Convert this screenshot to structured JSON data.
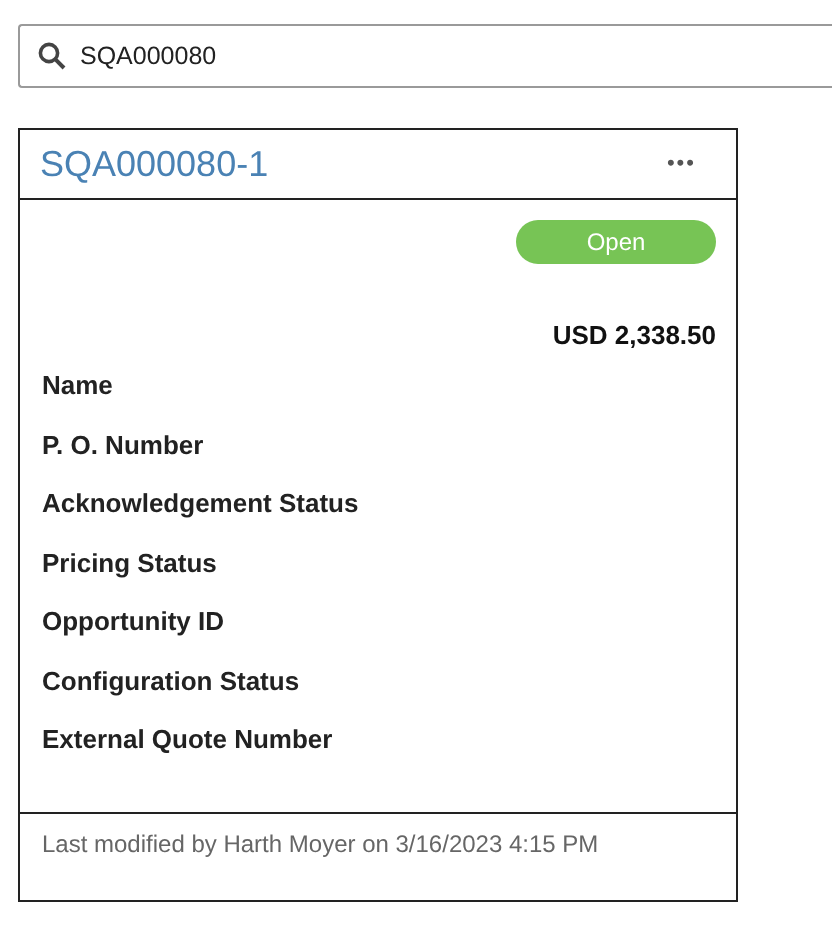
{
  "search": {
    "value": "SQA000080"
  },
  "card": {
    "title": "SQA000080-1",
    "menu": "•••",
    "status": "Open",
    "amount": "USD 2,338.50",
    "fields": [
      "Name",
      "P. O. Number",
      "Acknowledgement Status",
      "Pricing Status",
      "Opportunity ID",
      "Configuration Status",
      "External Quote Number"
    ],
    "footer": "Last modified by Harth Moyer on 3/16/2023 4:15 PM"
  }
}
